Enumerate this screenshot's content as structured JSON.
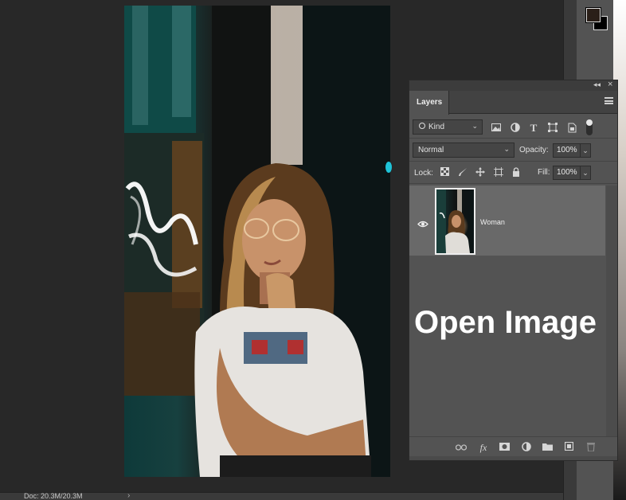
{
  "status": {
    "doc_info": "Doc: 20.3M/20.3M",
    "arrow": "›"
  },
  "panel": {
    "collapse_glyph": "◂◂",
    "close_glyph": "×",
    "tab_label": "Layers",
    "filter": {
      "kind_label": "Kind",
      "icons": [
        "image-filter-icon",
        "adjustment-filter-icon",
        "type-filter-icon",
        "shape-filter-icon",
        "smart-object-filter-icon"
      ]
    },
    "blend_mode": "Normal",
    "opacity_label": "Opacity:",
    "opacity_value": "100%",
    "lock_label": "Lock:",
    "lock_icons": [
      "lock-transparent-icon",
      "lock-image-icon",
      "lock-position-icon",
      "lock-artboard-icon",
      "lock-all-icon"
    ],
    "fill_label": "Fill:",
    "fill_value": "100%",
    "layers": [
      {
        "name": "Woman",
        "visible": true
      }
    ],
    "overlay_caption": "Open Image",
    "bottom_icons": [
      "link-layers-icon",
      "fx-icon",
      "add-mask-icon",
      "new-adjustment-icon",
      "new-group-icon",
      "new-layer-icon",
      "delete-layer-icon"
    ]
  },
  "glyphs": {
    "chevron": "⌄",
    "type_T": "T",
    "fx": "fx"
  },
  "colors": {
    "foreground": "#2a1f18",
    "background": "#000000",
    "accent_dot": "#1ec3d8"
  }
}
